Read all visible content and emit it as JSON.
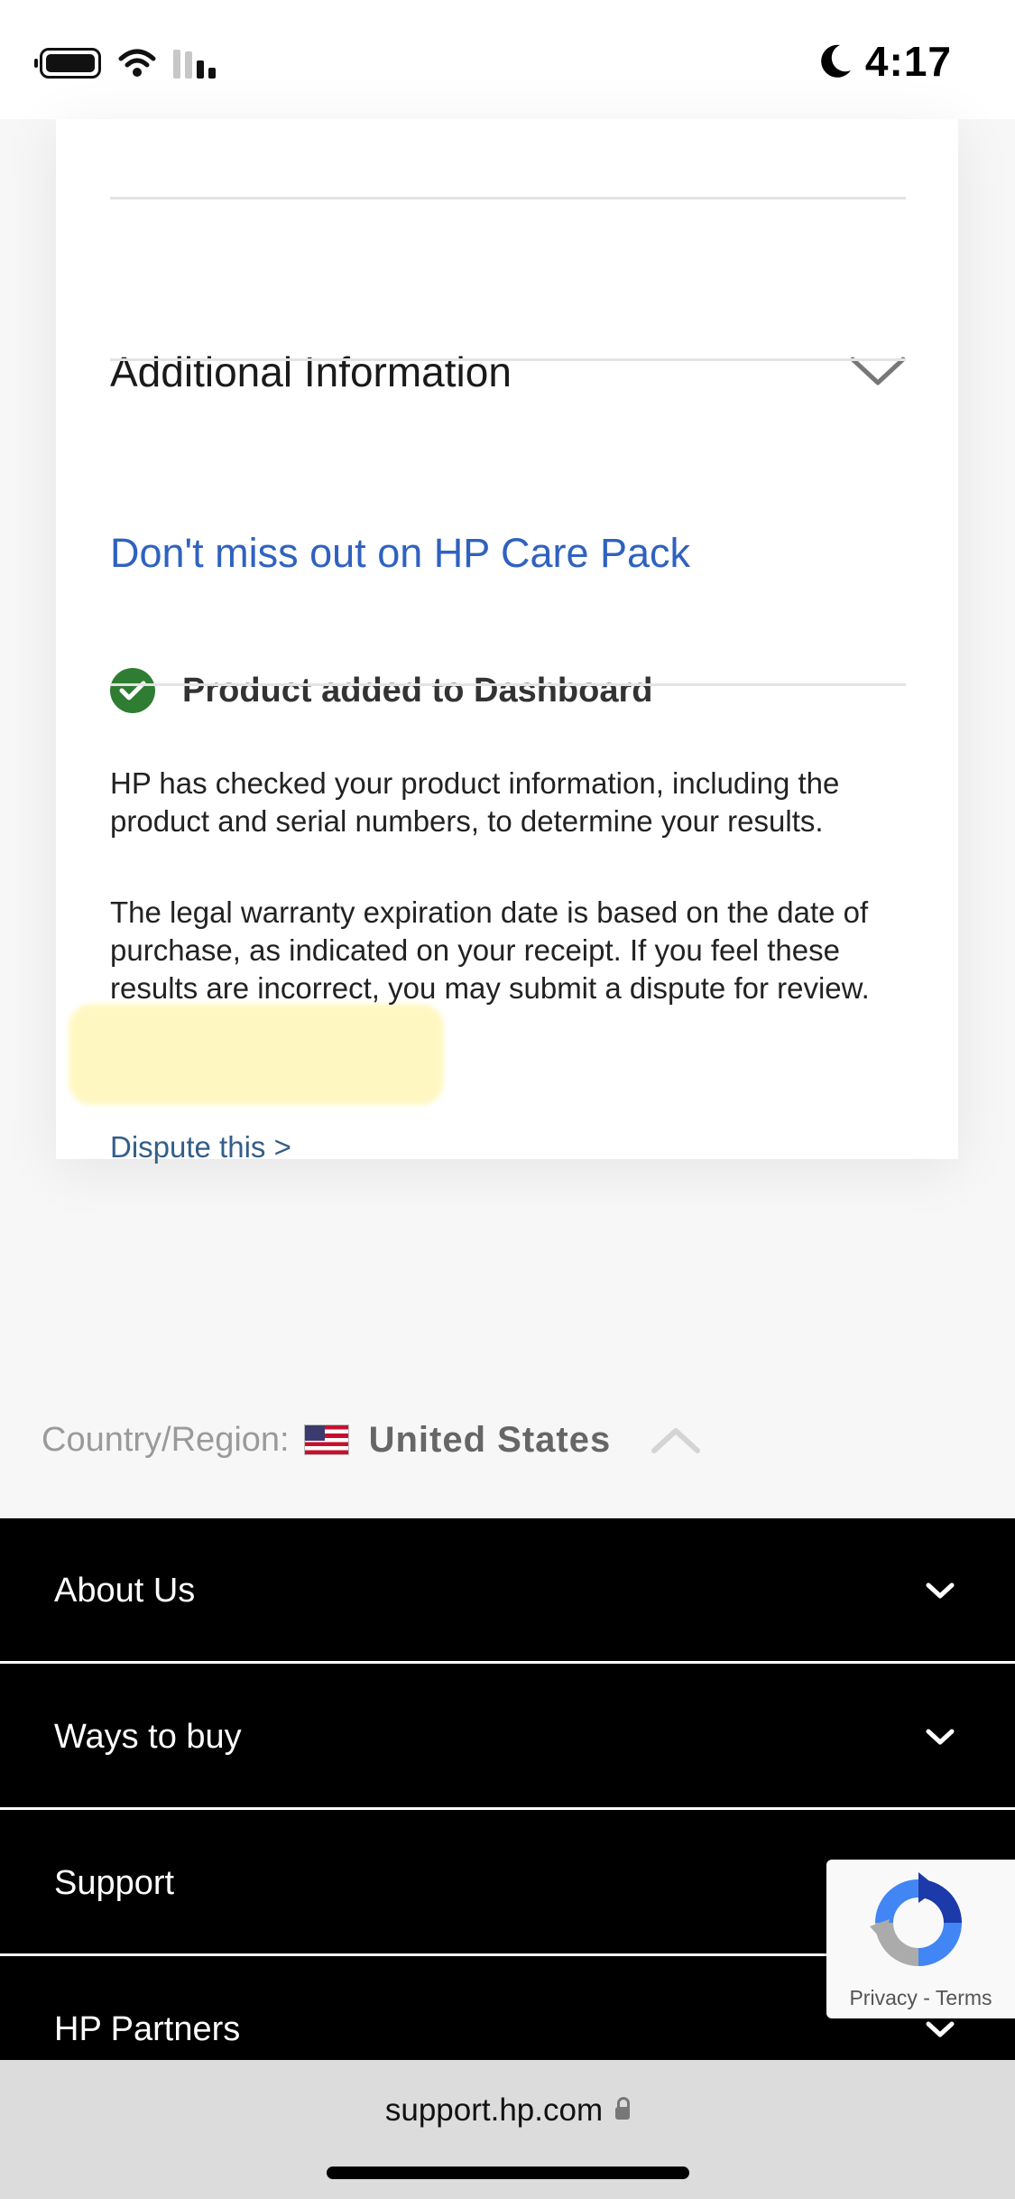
{
  "status_bar": {
    "time": "4:17",
    "icons": [
      "battery-icon",
      "wifi-icon",
      "cellular-signal-icon",
      "moon-icon"
    ]
  },
  "card": {
    "additional_information": "Additional Information",
    "care_pack_link": "Don't miss out on HP Care Pack",
    "added_status": "Product added to Dashboard",
    "paragraph1": "HP has checked your product information, including the product and serial numbers, to determine your results.",
    "paragraph2": "The legal warranty expiration date is based on the date of purchase, as indicated on your receipt. If you feel these results are incorrect, you may submit a dispute for review.",
    "dispute_link": "Dispute this >",
    "colors": {
      "link_blue": "#2f62bf",
      "dispute_blue": "#335e8a",
      "check_green": "#2e7d32",
      "highlight_yellow": "#fff6b8"
    }
  },
  "country": {
    "label": "Country/Region:",
    "value": "United States",
    "flag_icon": "us-flag-icon"
  },
  "footer": {
    "items": [
      {
        "label": "About Us"
      },
      {
        "label": "Ways to buy"
      },
      {
        "label": "Support"
      },
      {
        "label": "HP Partners"
      }
    ]
  },
  "recaptcha": {
    "privacy": "Privacy",
    "separator": "-",
    "terms": "Terms"
  },
  "browser": {
    "url": "support.hp.com"
  }
}
